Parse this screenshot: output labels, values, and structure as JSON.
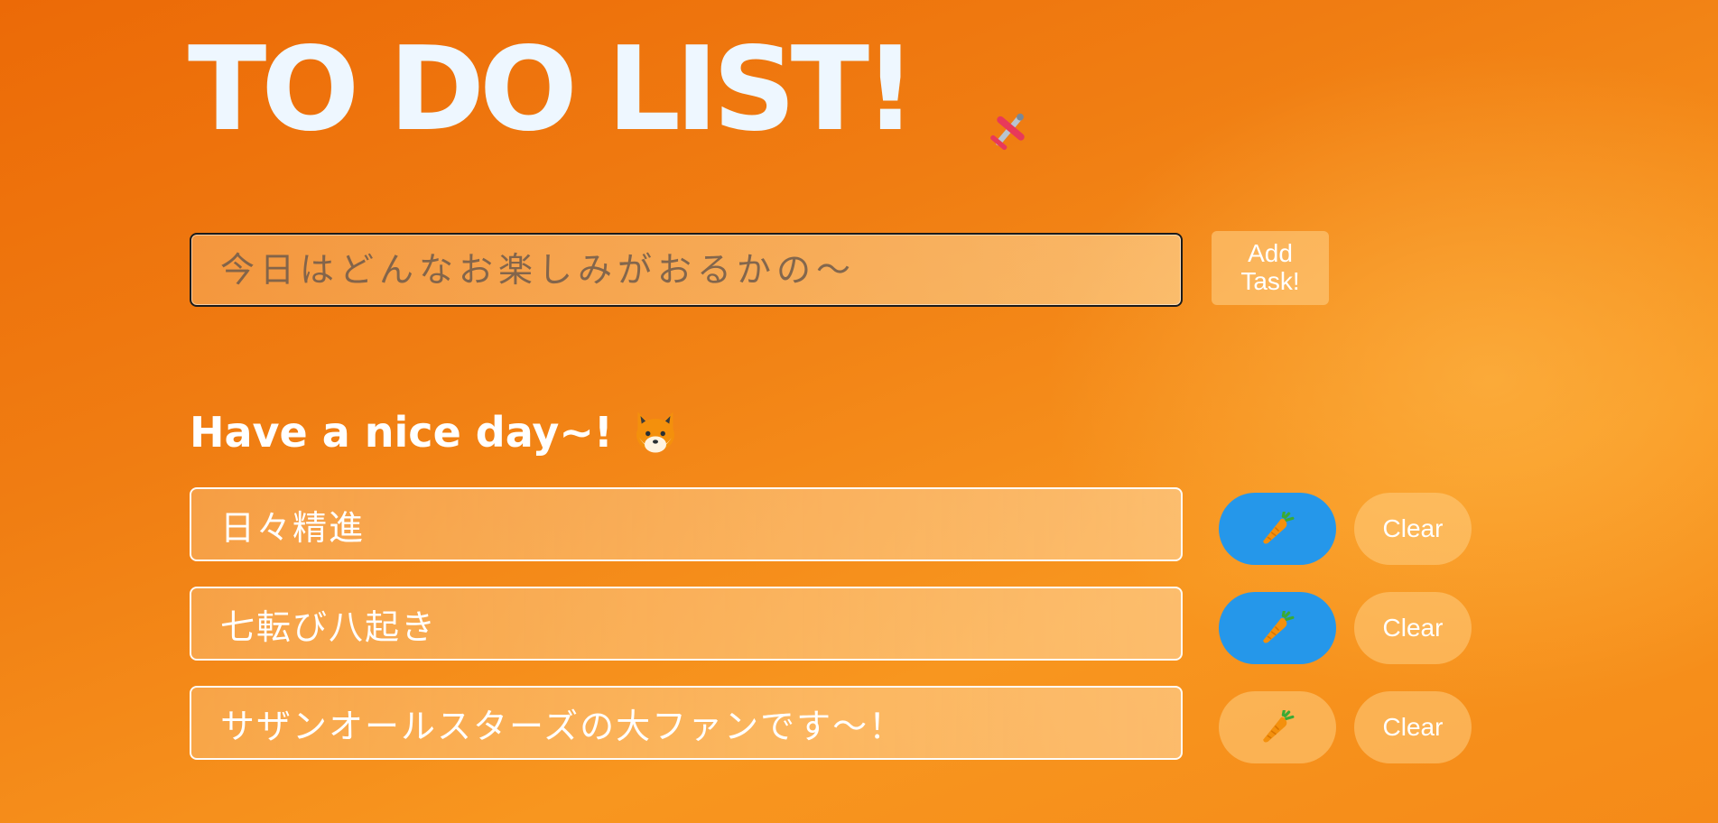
{
  "header": {
    "title": "TO DO LIST!",
    "title_color": "#eef7ff",
    "decoration_icon": "airplane-icon"
  },
  "new_task": {
    "placeholder": "今日はどんなお楽しみがおるかの～",
    "value": "",
    "add_button_label": "Add\nTask!"
  },
  "list": {
    "greeting": "Have a nice day~!",
    "greeting_icon": "fox-face-icon",
    "carrot_icon": "carrot-icon",
    "clear_label": "Clear",
    "tasks": [
      {
        "text": "日々精進",
        "carrot_active": true
      },
      {
        "text": "七転び八起き",
        "carrot_active": true
      },
      {
        "text": "サザンオールスターズの大ファンです～！",
        "carrot_active": false
      }
    ]
  },
  "colors": {
    "active_button": "#2597ea",
    "background_start": "#ec6a07",
    "background_end": "#f8961f"
  }
}
